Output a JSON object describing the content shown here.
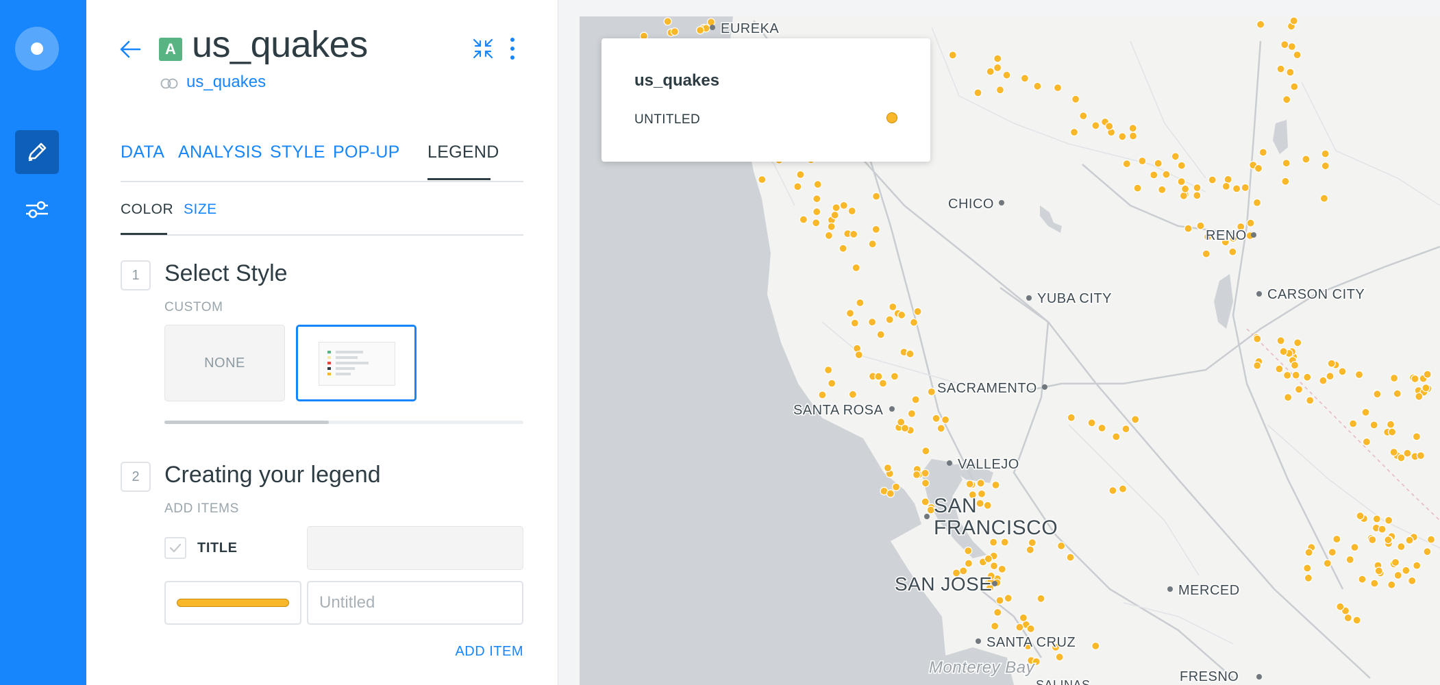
{
  "header": {
    "badge_letter": "A",
    "title": "us_quakes",
    "source_link": "us_quakes"
  },
  "tabs": [
    {
      "label": "DATA",
      "active": false
    },
    {
      "label": "ANALYSIS",
      "active": false
    },
    {
      "label": "STYLE",
      "active": false
    },
    {
      "label": "POP-UP",
      "active": false
    },
    {
      "label": "LEGEND",
      "active": true
    }
  ],
  "subtabs": [
    {
      "label": "COLOR",
      "active": true
    },
    {
      "label": "SIZE",
      "active": false
    }
  ],
  "select_style": {
    "step": "1",
    "title": "Select Style",
    "label": "CUSTOM",
    "option_none": "NONE"
  },
  "create_legend": {
    "step": "2",
    "title": "Creating your legend",
    "label": "ADD ITEMS",
    "title_label": "TITLE",
    "title_checked": true,
    "item_placeholder": "Untitled",
    "item_color": "#f9b72a",
    "add_item": "ADD ITEM"
  },
  "map": {
    "legend": {
      "title": "us_quakes",
      "item_label": "UNTITLED",
      "item_color": "#f9b72a"
    },
    "cities": [
      "EUREKA",
      "CHICO",
      "RENO",
      "YUBA CITY",
      "CARSON CITY",
      "SACRAMENTO",
      "SANTA ROSA",
      "VALLEJO",
      "SAN",
      "FRANCISCO",
      "SAN JOSE",
      "MERCED",
      "SANTA CRUZ",
      "FRESNO",
      "Monterey Bay",
      "SALINAS"
    ]
  },
  "colors": {
    "accent": "#1785fb",
    "rail": "#1785fb",
    "badge": "#59b484",
    "quake_point": "#f9b72a"
  },
  "icons": {
    "rail": [
      "logo-icon",
      "pencil-icon",
      "sliders-icon"
    ],
    "header": [
      "back-arrow-icon",
      "collapse-icon",
      "kebab-menu-icon",
      "dataset-toggle-icon"
    ]
  }
}
